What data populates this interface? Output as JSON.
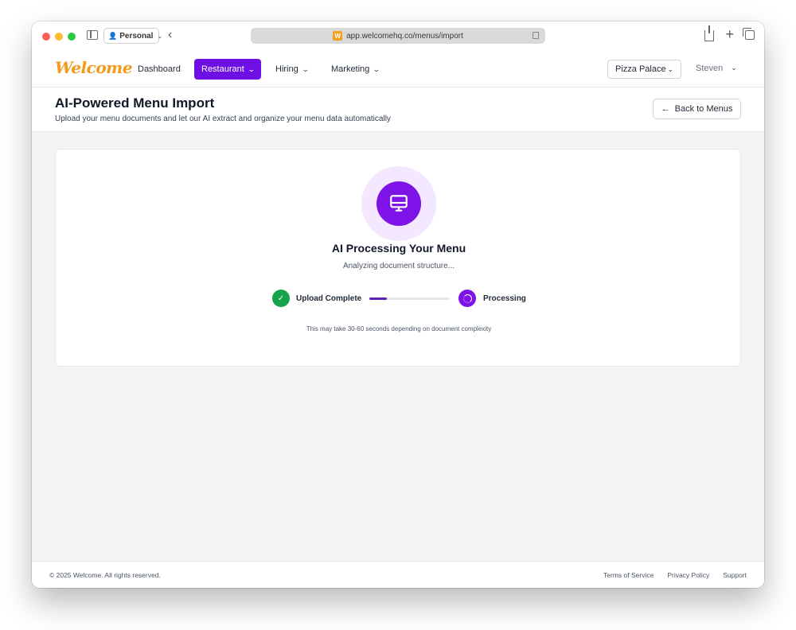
{
  "browser": {
    "profile_label": "Personal",
    "url": "app.welcomehq.co/menus/import",
    "favicon_letter": "W",
    "traffic_colors": [
      "#ff5f57",
      "#febc2e",
      "#28c840"
    ]
  },
  "nav": {
    "logo": "Welcome",
    "items": [
      {
        "label": "Dashboard",
        "has_dropdown": false,
        "active": false
      },
      {
        "label": "Restaurant",
        "has_dropdown": true,
        "active": true
      },
      {
        "label": "Hiring",
        "has_dropdown": true,
        "active": false
      },
      {
        "label": "Marketing",
        "has_dropdown": true,
        "active": false
      }
    ],
    "restaurant_selector": "Pizza Palace",
    "user_name": "Steven",
    "accent_color": "#6e0fe3"
  },
  "header": {
    "title": "AI-Powered Menu Import",
    "subtitle": "Upload your menu documents and let our AI extract and organize your menu data automatically",
    "back_button_label": "Back to Menus"
  },
  "processing": {
    "title": "AI Processing Your Menu",
    "status": "Analyzing document structure...",
    "step1_label": "Upload Complete",
    "step2_label": "Processing",
    "progress_fraction": 0.22,
    "note": "This may take 30-60 seconds depending on document complexity",
    "icon": "monitor-icon",
    "success_color": "#16a34a",
    "processing_color": "#7d13e6"
  },
  "footer": {
    "copyright": "© 2025 Welcome. All rights reserved.",
    "links": [
      "Terms of Service",
      "Privacy Policy",
      "Support"
    ]
  }
}
